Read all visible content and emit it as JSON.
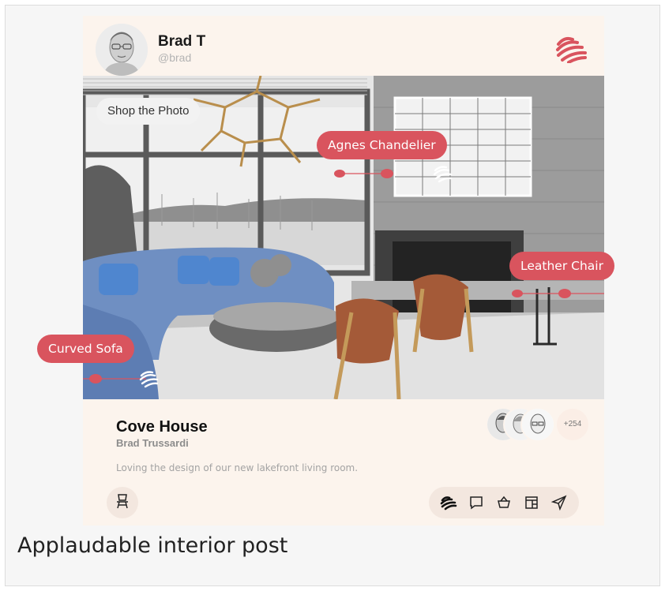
{
  "post": {
    "user_name": "Brad T",
    "user_handle": "@brad",
    "shop_label": "Shop the Photo",
    "tags": [
      {
        "label": "Agnes Chandelier"
      },
      {
        "label": "Leather Chair"
      },
      {
        "label": "Curved Sofa"
      }
    ],
    "title": "Cove House",
    "author": "Brad Trussardi",
    "caption": "Loving the design of our new lakefront living room.",
    "collaborators_more": "+254"
  },
  "page_caption": "Applaudable interior post",
  "colors": {
    "accent": "#d9545e",
    "card_bg": "#fcf4ed",
    "action_bg": "#f3e7df"
  },
  "icons": {
    "brand": "applaud-hands-icon",
    "actions": [
      "applaud-icon",
      "comment-icon",
      "basket-icon",
      "save-board-icon",
      "send-icon"
    ],
    "chair": "chair-icon"
  }
}
